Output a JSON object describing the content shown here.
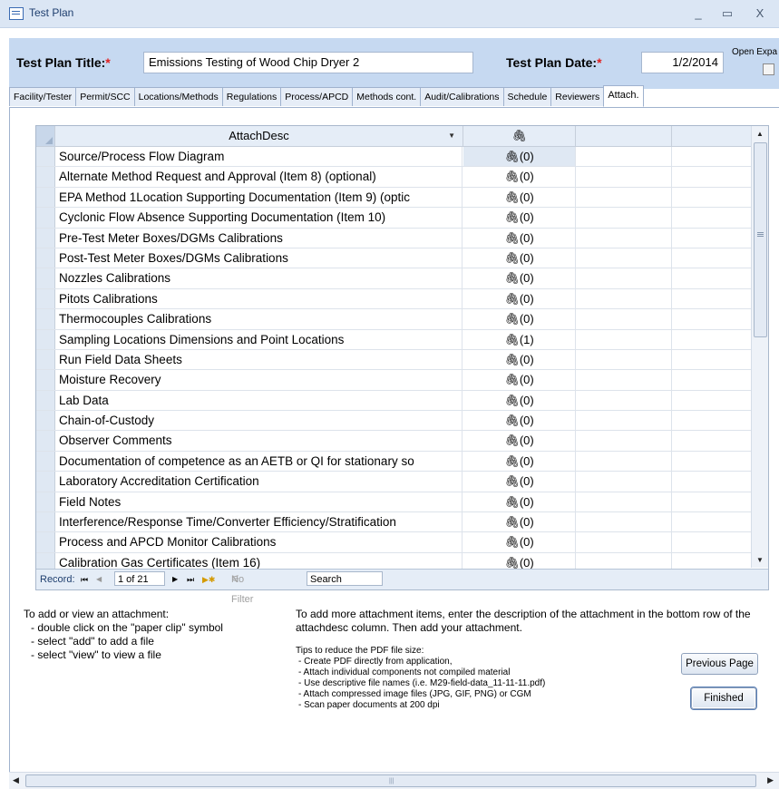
{
  "window": {
    "title": "Test Plan",
    "minimize": "_",
    "maximize": "▭",
    "close": "X"
  },
  "header": {
    "title_label": "Test Plan Title:",
    "title_value": "Emissions Testing of Wood Chip Dryer 2",
    "date_label": "Test Plan Date:",
    "date_value": "1/2/2014",
    "required_mark": "*",
    "open_exp_label": "Open Expa"
  },
  "tabs": [
    "Facility/Tester",
    "Permit/SCC",
    "Locations/Methods",
    "Regulations",
    "Process/APCD",
    "Methods cont.",
    "Audit/Calibrations",
    "Schedule",
    "Reviewers",
    "Attach."
  ],
  "grid": {
    "col_desc": "AttachDesc",
    "rows": [
      {
        "desc": "Source/Process Flow Diagram",
        "att": "(0)"
      },
      {
        "desc": "Alternate Method Request and Approval (Item 8) (optional)",
        "att": "(0)"
      },
      {
        "desc": "EPA Method 1Location Supporting Documentation (Item 9) (optic",
        "att": "(0)"
      },
      {
        "desc": "Cyclonic Flow Absence Supporting Documentation (Item 10)",
        "att": "(0)"
      },
      {
        "desc": "Pre-Test Meter Boxes/DGMs Calibrations",
        "att": "(0)"
      },
      {
        "desc": "Post-Test Meter Boxes/DGMs Calibrations",
        "att": "(0)"
      },
      {
        "desc": "Nozzles Calibrations",
        "att": "(0)"
      },
      {
        "desc": "Pitots Calibrations",
        "att": "(0)"
      },
      {
        "desc": "Thermocouples Calibrations",
        "att": "(0)"
      },
      {
        "desc": "Sampling Locations Dimensions and Point Locations",
        "att": "(1)"
      },
      {
        "desc": "Run Field Data Sheets",
        "att": "(0)"
      },
      {
        "desc": "Moisture Recovery",
        "att": "(0)"
      },
      {
        "desc": "Lab Data",
        "att": "(0)"
      },
      {
        "desc": "Chain-of-Custody",
        "att": "(0)"
      },
      {
        "desc": "Observer Comments",
        "att": "(0)"
      },
      {
        "desc": "Documentation of competence as an AETB or QI for stationary so",
        "att": "(0)"
      },
      {
        "desc": "Laboratory Accreditation Certification",
        "att": "(0)"
      },
      {
        "desc": "Field Notes",
        "att": "(0)"
      },
      {
        "desc": "Interference/Response Time/Converter Efficiency/Stratification",
        "att": "(0)"
      },
      {
        "desc": "Process and APCD Monitor Calibrations",
        "att": "(0)"
      },
      {
        "desc": "Calibration Gas Certificates (Item 16)",
        "att": "(0)"
      }
    ]
  },
  "navbar": {
    "record_label": "Record:",
    "record_value": "1 of 21",
    "no_filter": "No Filter",
    "search": "Search"
  },
  "help_left": {
    "heading": "To add or view an attachment:",
    "lines": [
      "- double click on the \"paper clip\" symbol",
      "- select \"add\" to add a file",
      "- select \"view\" to view a file"
    ]
  },
  "help_right": {
    "text": "To add more attachment items, enter the description of the attachment in the bottom row of the attachdesc column. Then add your attachment.",
    "tips_heading": "Tips to reduce the PDF file size:",
    "tips": [
      "- Create PDF directly from application,",
      "- Attach individual components not compiled material",
      "- Use descriptive file names (i.e. M29-field-data_11-11-11.pdf)",
      "- Attach compressed image files (JPG, GIF, PNG) or CGM",
      "- Scan paper documents at 200 dpi"
    ]
  },
  "buttons": {
    "previous": "Previous Page",
    "finished": "Finished"
  }
}
